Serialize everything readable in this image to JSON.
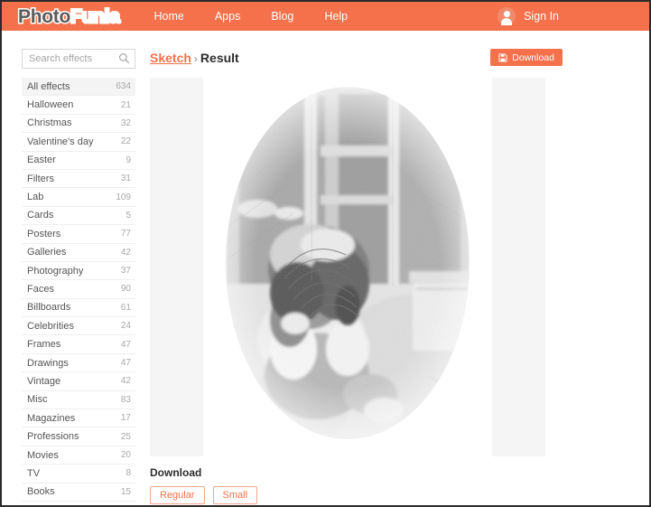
{
  "brand": {
    "logo_part1": "Photo",
    "logo_part2": "Funia",
    "accent_color": "#f4714b",
    "panel_color": "#f5f5f5"
  },
  "nav": {
    "links": [
      {
        "label": "Home"
      },
      {
        "label": "Apps"
      },
      {
        "label": "Blog"
      },
      {
        "label": "Help"
      }
    ],
    "signin_label": "Sign In",
    "avatar_icon": "user-avatar-icon"
  },
  "sidebar": {
    "search": {
      "placeholder": "Search effects",
      "value": "",
      "icon": "search-icon"
    },
    "categories": [
      {
        "label": "All effects",
        "count": "634",
        "active": true
      },
      {
        "label": "Halloween",
        "count": "21",
        "active": false
      },
      {
        "label": "Christmas",
        "count": "32",
        "active": false
      },
      {
        "label": "Valentine's day",
        "count": "22",
        "active": false
      },
      {
        "label": "Easter",
        "count": "9",
        "active": false
      },
      {
        "label": "Filters",
        "count": "31",
        "active": false
      },
      {
        "label": "Lab",
        "count": "109",
        "active": false
      },
      {
        "label": "Cards",
        "count": "5",
        "active": false
      },
      {
        "label": "Posters",
        "count": "77",
        "active": false
      },
      {
        "label": "Galleries",
        "count": "42",
        "active": false
      },
      {
        "label": "Photography",
        "count": "37",
        "active": false
      },
      {
        "label": "Faces",
        "count": "90",
        "active": false
      },
      {
        "label": "Billboards",
        "count": "61",
        "active": false
      },
      {
        "label": "Celebrities",
        "count": "24",
        "active": false
      },
      {
        "label": "Frames",
        "count": "47",
        "active": false
      },
      {
        "label": "Drawings",
        "count": "47",
        "active": false
      },
      {
        "label": "Vintage",
        "count": "42",
        "active": false
      },
      {
        "label": "Misc",
        "count": "83",
        "active": false
      },
      {
        "label": "Magazines",
        "count": "17",
        "active": false
      },
      {
        "label": "Professions",
        "count": "25",
        "active": false
      },
      {
        "label": "Movies",
        "count": "20",
        "active": false
      },
      {
        "label": "TV",
        "count": "8",
        "active": false
      },
      {
        "label": "Books",
        "count": "15",
        "active": false
      }
    ]
  },
  "main": {
    "breadcrumb": {
      "link_label": "Sketch",
      "separator": "›",
      "current_label": "Result"
    },
    "download_button": {
      "label": "Download",
      "icon": "save-disk-icon"
    },
    "result_image": {
      "alt": "pencil sketch of a child crouching outdoors",
      "effect_name": "Sketch"
    },
    "download_section": {
      "title": "Download",
      "options": [
        {
          "label": "Regular"
        },
        {
          "label": "Small"
        }
      ]
    }
  }
}
